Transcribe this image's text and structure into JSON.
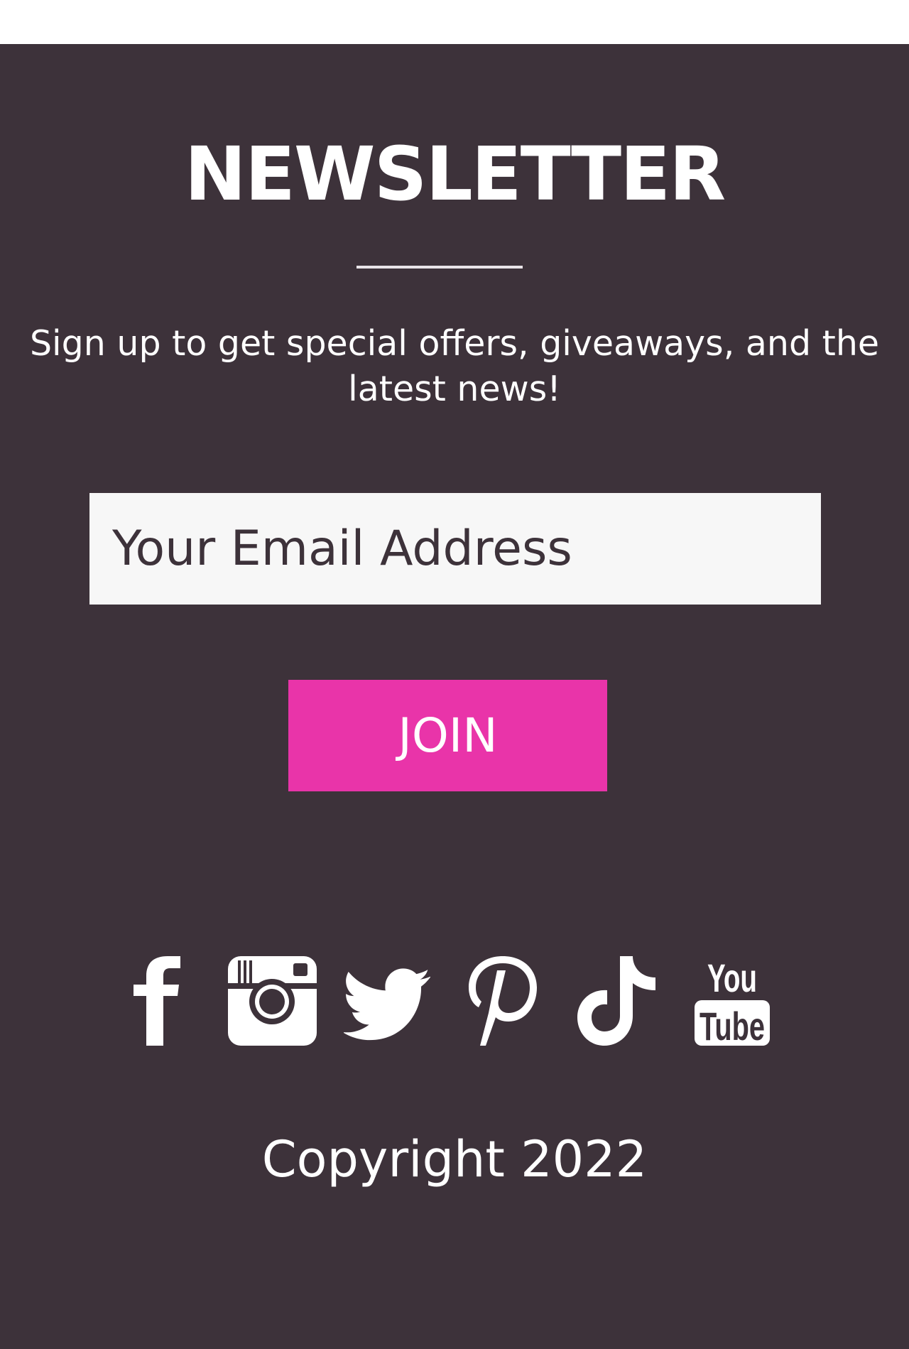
{
  "newsletter": {
    "title": "NEWSLETTER",
    "subtitle": "Sign up to get special offers, giveaways, and the latest news!",
    "email_placeholder": "Your Email Address",
    "join_label": "JOIN"
  },
  "social": {
    "icons": [
      "facebook-icon",
      "instagram-icon",
      "twitter-icon",
      "pinterest-icon",
      "tiktok-icon",
      "youtube-icon"
    ],
    "youtube_you": "You",
    "youtube_tube": "Tube"
  },
  "footer": {
    "copyright": "Copyright 2022"
  },
  "colors": {
    "background": "#3d323a",
    "accent": "#e934a9",
    "field": "#f7f7f7",
    "text": "#ffffff"
  }
}
